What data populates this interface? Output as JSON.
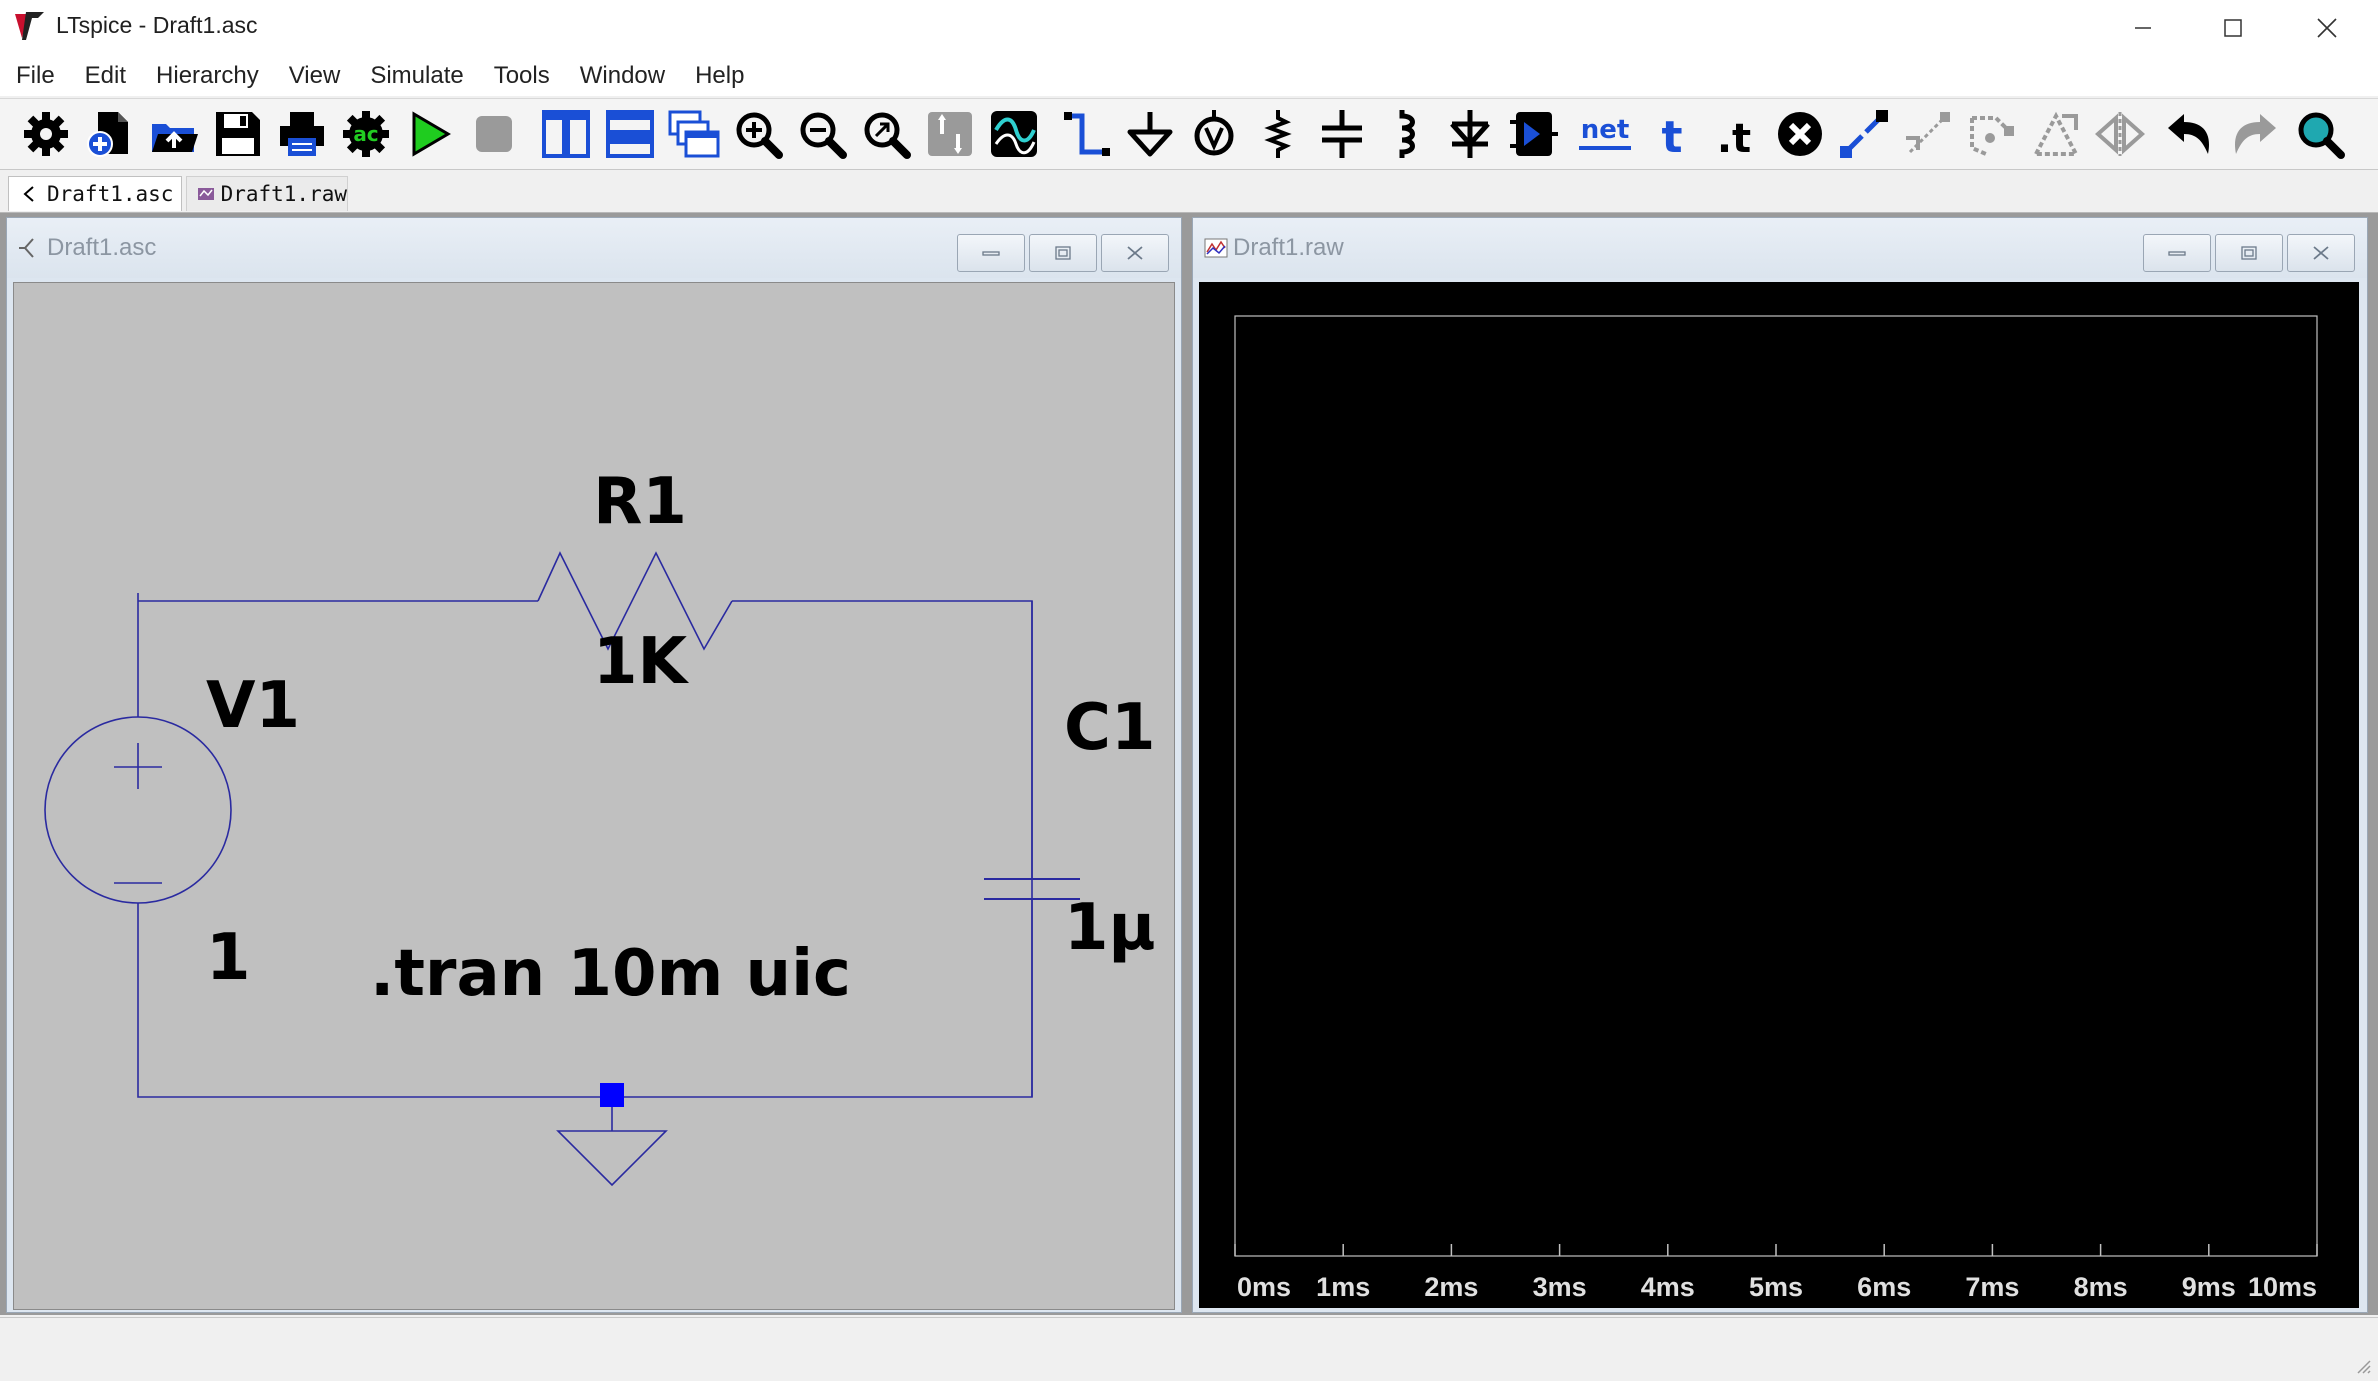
{
  "window": {
    "title": "LTspice - Draft1.asc",
    "controls": [
      "minimize",
      "maximize",
      "close"
    ]
  },
  "menu": [
    "File",
    "Edit",
    "Hierarchy",
    "View",
    "Simulate",
    "Tools",
    "Window",
    "Help"
  ],
  "toolbar": {
    "buttons": [
      {
        "name": "settings",
        "icon": "gear-icon",
        "enabled": true
      },
      {
        "name": "new-schematic",
        "icon": "new-document-icon",
        "enabled": true
      },
      {
        "name": "open",
        "icon": "open-folder-icon",
        "enabled": true
      },
      {
        "name": "save",
        "icon": "floppy-disk-icon",
        "enabled": true
      },
      {
        "name": "print",
        "icon": "printer-icon",
        "enabled": true
      },
      {
        "name": "control-panel",
        "icon": "ac-gear-icon",
        "enabled": true
      },
      {
        "name": "run",
        "icon": "run-icon",
        "enabled": true
      },
      {
        "name": "halt",
        "icon": "stop-icon",
        "enabled": false
      },
      {
        "name": "tile-vertically",
        "icon": "tile-vertical-icon",
        "enabled": true
      },
      {
        "name": "tile-horizontally",
        "icon": "tile-horizontal-icon",
        "enabled": true
      },
      {
        "name": "cascade",
        "icon": "cascade-windows-icon",
        "enabled": true
      },
      {
        "name": "zoom-in",
        "icon": "zoom-in-icon",
        "enabled": true
      },
      {
        "name": "zoom-out",
        "icon": "zoom-out-icon",
        "enabled": true
      },
      {
        "name": "zoom-fit",
        "icon": "zoom-fit-icon",
        "enabled": true
      },
      {
        "name": "pan",
        "icon": "pan-icon",
        "enabled": false
      },
      {
        "name": "waveform",
        "icon": "waveform-icon",
        "enabled": true
      },
      {
        "name": "draw-wire",
        "icon": "wire-icon",
        "enabled": true
      },
      {
        "name": "ground",
        "icon": "ground-icon",
        "enabled": true
      },
      {
        "name": "voltage-label",
        "icon": "label-net-icon",
        "enabled": true
      },
      {
        "name": "resistor",
        "icon": "resistor-icon",
        "enabled": true
      },
      {
        "name": "capacitor",
        "icon": "capacitor-icon",
        "enabled": true
      },
      {
        "name": "inductor",
        "icon": "inductor-icon",
        "enabled": true
      },
      {
        "name": "diode",
        "icon": "diode-icon",
        "enabled": true
      },
      {
        "name": "component",
        "icon": "component-icon",
        "enabled": true
      },
      {
        "name": "netlist",
        "icon": "net-icon",
        "enabled": true,
        "label": "net"
      },
      {
        "name": "text",
        "icon": "text-icon",
        "enabled": true,
        "label": "t"
      },
      {
        "name": "spice-directive",
        "icon": "spice-directive-icon",
        "enabled": true,
        "label": ".t"
      },
      {
        "name": "delete",
        "icon": "delete-icon",
        "enabled": true
      },
      {
        "name": "duplicate",
        "icon": "duplicate-icon",
        "enabled": true
      },
      {
        "name": "move",
        "icon": "move-icon",
        "enabled": false
      },
      {
        "name": "drag",
        "icon": "drag-icon",
        "enabled": false
      },
      {
        "name": "rotate",
        "icon": "rotate-icon",
        "enabled": false
      },
      {
        "name": "mirror",
        "icon": "mirror-icon",
        "enabled": false
      },
      {
        "name": "undo",
        "icon": "undo-icon",
        "enabled": true
      },
      {
        "name": "redo",
        "icon": "redo-icon",
        "enabled": false
      },
      {
        "name": "find",
        "icon": "find-icon",
        "enabled": true
      }
    ]
  },
  "tabs": [
    {
      "label": "Draft1.asc",
      "icon": "schematic-icon",
      "active": true
    },
    {
      "label": "Draft1.raw",
      "icon": "waveform-icon",
      "active": false
    }
  ],
  "schematic": {
    "title": "Draft1.asc",
    "background": "#c0c0c0",
    "wire_color": "#2a2aa0",
    "text_color": "#000000",
    "components": {
      "r1": {
        "name": "R1",
        "value": "1K"
      },
      "v1": {
        "name": "V1",
        "value": "1"
      },
      "c1": {
        "name": "C1",
        "value": "1µ"
      }
    },
    "directive": ".tran 10m uic"
  },
  "waveform": {
    "title": "Draft1.raw",
    "background": "#000000",
    "axis_color": "#c0c0c0",
    "x_ticks": [
      "0ms",
      "1ms",
      "2ms",
      "3ms",
      "4ms",
      "5ms",
      "6ms",
      "7ms",
      "8ms",
      "9ms",
      "10ms"
    ]
  },
  "status": {
    "text": ""
  }
}
